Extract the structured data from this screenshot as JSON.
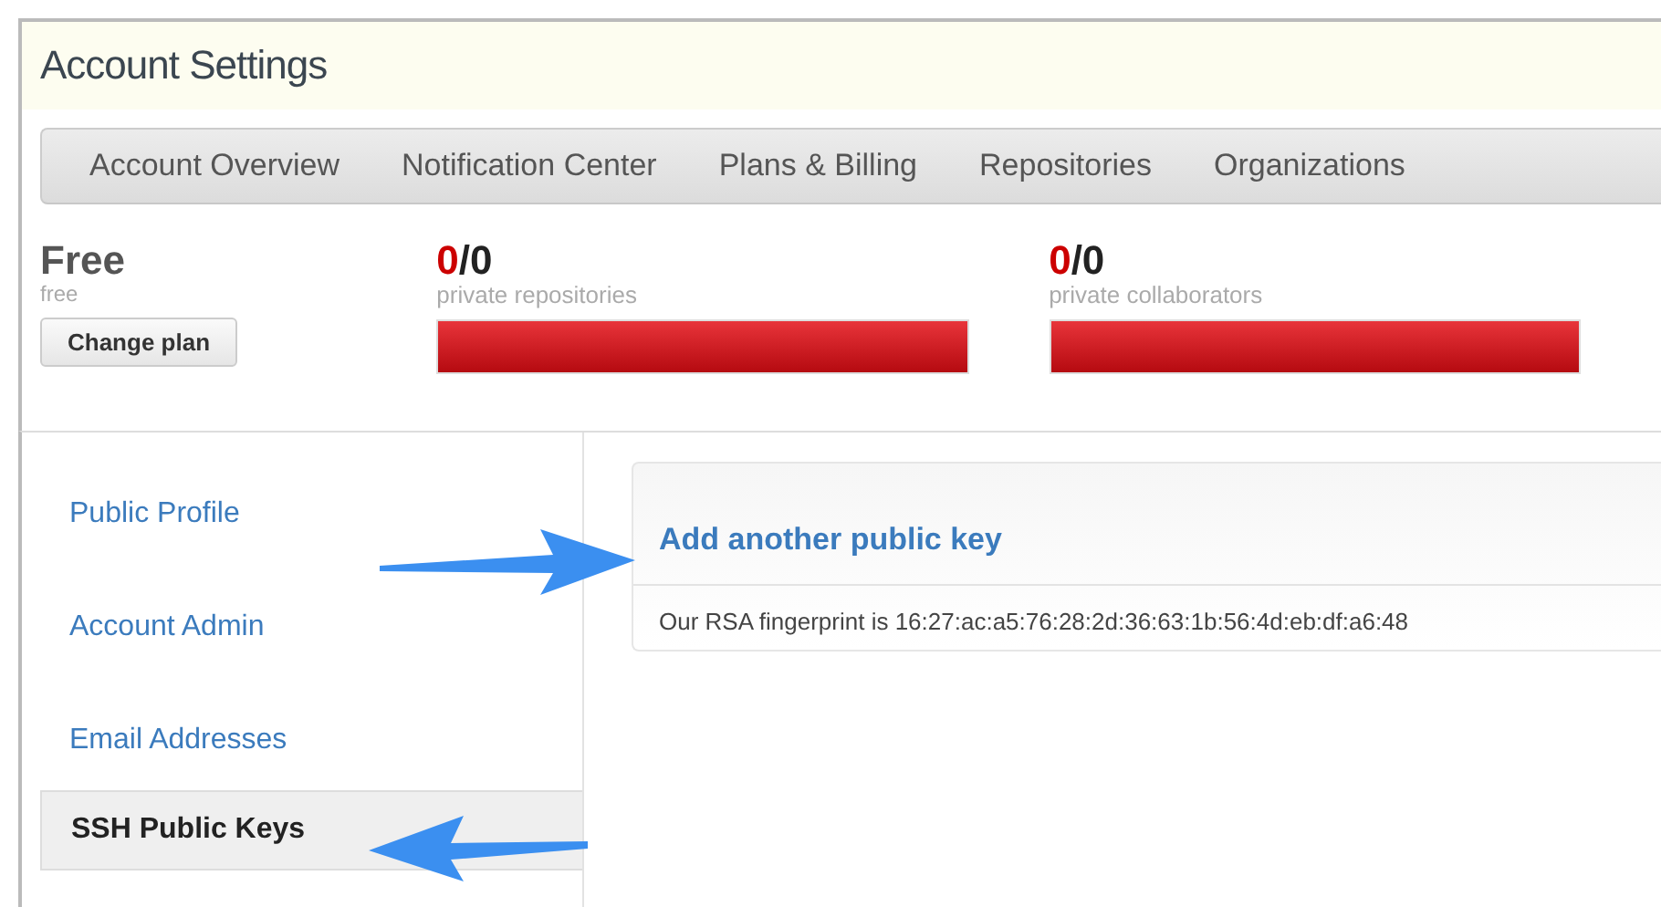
{
  "title": "Account Settings",
  "tabs": [
    {
      "label": "Account Overview",
      "selected": false
    },
    {
      "label": "Notification Center",
      "selected": false
    },
    {
      "label": "Plans & Billing",
      "selected": false
    },
    {
      "label": "Repositories",
      "selected": false
    },
    {
      "label": "Organizations",
      "selected": false
    }
  ],
  "plan": {
    "name": "Free",
    "sub": "free",
    "button": "Change plan"
  },
  "meters": [
    {
      "used": "0",
      "rest": "/0",
      "label": "private repositories",
      "level": 1
    },
    {
      "used": "0",
      "rest": "/0",
      "label": "private collaborators",
      "level": 1
    }
  ],
  "sidebar": [
    {
      "label": "Public Profile",
      "selected": false
    },
    {
      "label": "Account Admin",
      "selected": false
    },
    {
      "label": "Email Addresses",
      "selected": false
    },
    {
      "label": "SSH Public Keys",
      "selected": true
    }
  ],
  "panel": {
    "link": "Add another public key",
    "fingerprint": "Our RSA fingerprint is 16:27:ac:a5:76:28:2d:36:63:1b:56:4d:eb:df:a6:48"
  }
}
